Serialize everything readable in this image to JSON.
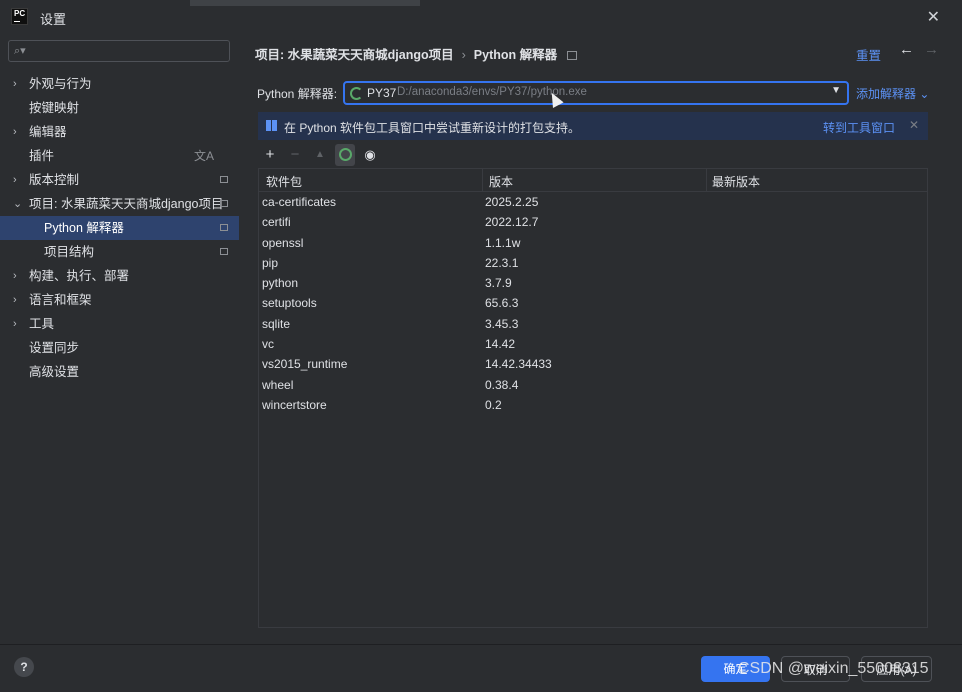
{
  "window": {
    "title": "设置",
    "logo_text": "PC"
  },
  "search": {
    "placeholder": ""
  },
  "sidebar": {
    "items": [
      {
        "label": "外观与行为",
        "expandable": true
      },
      {
        "label": "按键映射",
        "expandable": false
      },
      {
        "label": "编辑器",
        "expandable": true
      },
      {
        "label": "插件",
        "expandable": false
      },
      {
        "label": "版本控制",
        "expandable": true
      },
      {
        "label": "项目: 水果蔬菜天天商城django项目",
        "expandable": true,
        "expanded": true
      },
      {
        "label": "Python 解释器",
        "child": true,
        "selected": true
      },
      {
        "label": "项目结构",
        "child": true
      },
      {
        "label": "构建、执行、部署",
        "expandable": true
      },
      {
        "label": "语言和框架",
        "expandable": true
      },
      {
        "label": "工具",
        "expandable": true
      },
      {
        "label": "设置同步",
        "expandable": false
      },
      {
        "label": "高级设置",
        "expandable": false
      }
    ]
  },
  "header": {
    "breadcrumb_project": "项目: 水果蔬菜天天商城django项目",
    "breadcrumb_separator": "›",
    "breadcrumb_page": "Python 解释器",
    "reset_label": "重置"
  },
  "interpreter": {
    "label": "Python 解释器:",
    "name": "PY37",
    "path": "D:/anaconda3/envs/PY37/python.exe",
    "add_label": "添加解释器"
  },
  "banner": {
    "text": "在 Python 软件包工具窗口中尝试重新设计的打包支持。",
    "link": "转到工具窗口"
  },
  "table": {
    "headers": [
      "软件包",
      "版本",
      "最新版本"
    ],
    "rows": [
      [
        "ca-certificates",
        "2025.2.25",
        ""
      ],
      [
        "certifi",
        "2022.12.7",
        ""
      ],
      [
        "openssl",
        "1.1.1w",
        ""
      ],
      [
        "pip",
        "22.3.1",
        ""
      ],
      [
        "python",
        "3.7.9",
        ""
      ],
      [
        "setuptools",
        "65.6.3",
        ""
      ],
      [
        "sqlite",
        "3.45.3",
        ""
      ],
      [
        "vc",
        "14.42",
        ""
      ],
      [
        "vs2015_runtime",
        "14.42.34433",
        ""
      ],
      [
        "wheel",
        "0.38.4",
        ""
      ],
      [
        "wincertstore",
        "0.2",
        ""
      ]
    ]
  },
  "footer": {
    "help": "?",
    "ok": "确定",
    "cancel": "取消",
    "apply": "应用(A)"
  },
  "watermark": "CSDN @weixin_55008315",
  "colors": {
    "accent": "#3574f0",
    "link": "#5c92f5",
    "selection": "#2e436e",
    "background": "#2b2d30"
  }
}
